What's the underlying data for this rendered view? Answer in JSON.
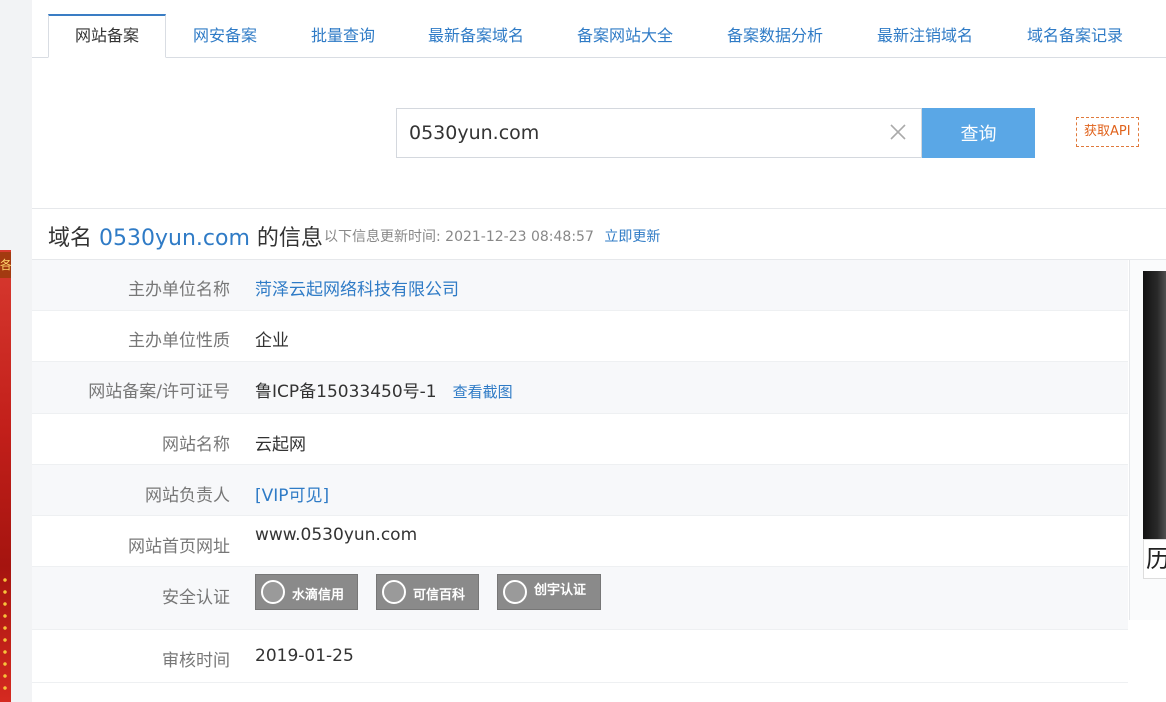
{
  "tabs": [
    {
      "label": "网站备案",
      "active": true
    },
    {
      "label": "网安备案"
    },
    {
      "label": "批量查询"
    },
    {
      "label": "最新备案域名"
    },
    {
      "label": "备案网站大全"
    },
    {
      "label": "备案数据分析"
    },
    {
      "label": "最新注销域名"
    },
    {
      "label": "域名备案记录"
    }
  ],
  "search": {
    "value": "0530yun.com",
    "button_label": "查询",
    "api_label": "获取API"
  },
  "info": {
    "prefix": "域名",
    "domain": "0530yun.com",
    "suffix": "的信息",
    "update_prefix": "以下信息更新时间:",
    "update_time": "2021-12-23 08:48:57",
    "refresh_label": "立即更新"
  },
  "rows": {
    "sponsor_name": {
      "label": "主办单位名称",
      "value": "菏泽云起网络科技有限公司"
    },
    "sponsor_type": {
      "label": "主办单位性质",
      "value": "企业"
    },
    "license": {
      "label": "网站备案/许可证号",
      "value": "鲁ICP备15033450号-1",
      "extra": "查看截图"
    },
    "site_name": {
      "label": "网站名称",
      "value": "云起网"
    },
    "owner": {
      "label": "网站负责人",
      "value": "[VIP可见]"
    },
    "homepage": {
      "label": "网站首页网址",
      "value": "www.0530yun.com"
    },
    "security": {
      "label": "安全认证",
      "badges": [
        "水滴信用",
        "可信百科",
        "创宇认证"
      ]
    },
    "review_time": {
      "label": "审核时间",
      "value": "2019-01-25"
    }
  },
  "side": {
    "caption": "历"
  },
  "left_strip_glyph": "各",
  "colors": {
    "link": "#2f7bc6",
    "button": "#5aa7e6",
    "api": "#e0621b"
  }
}
